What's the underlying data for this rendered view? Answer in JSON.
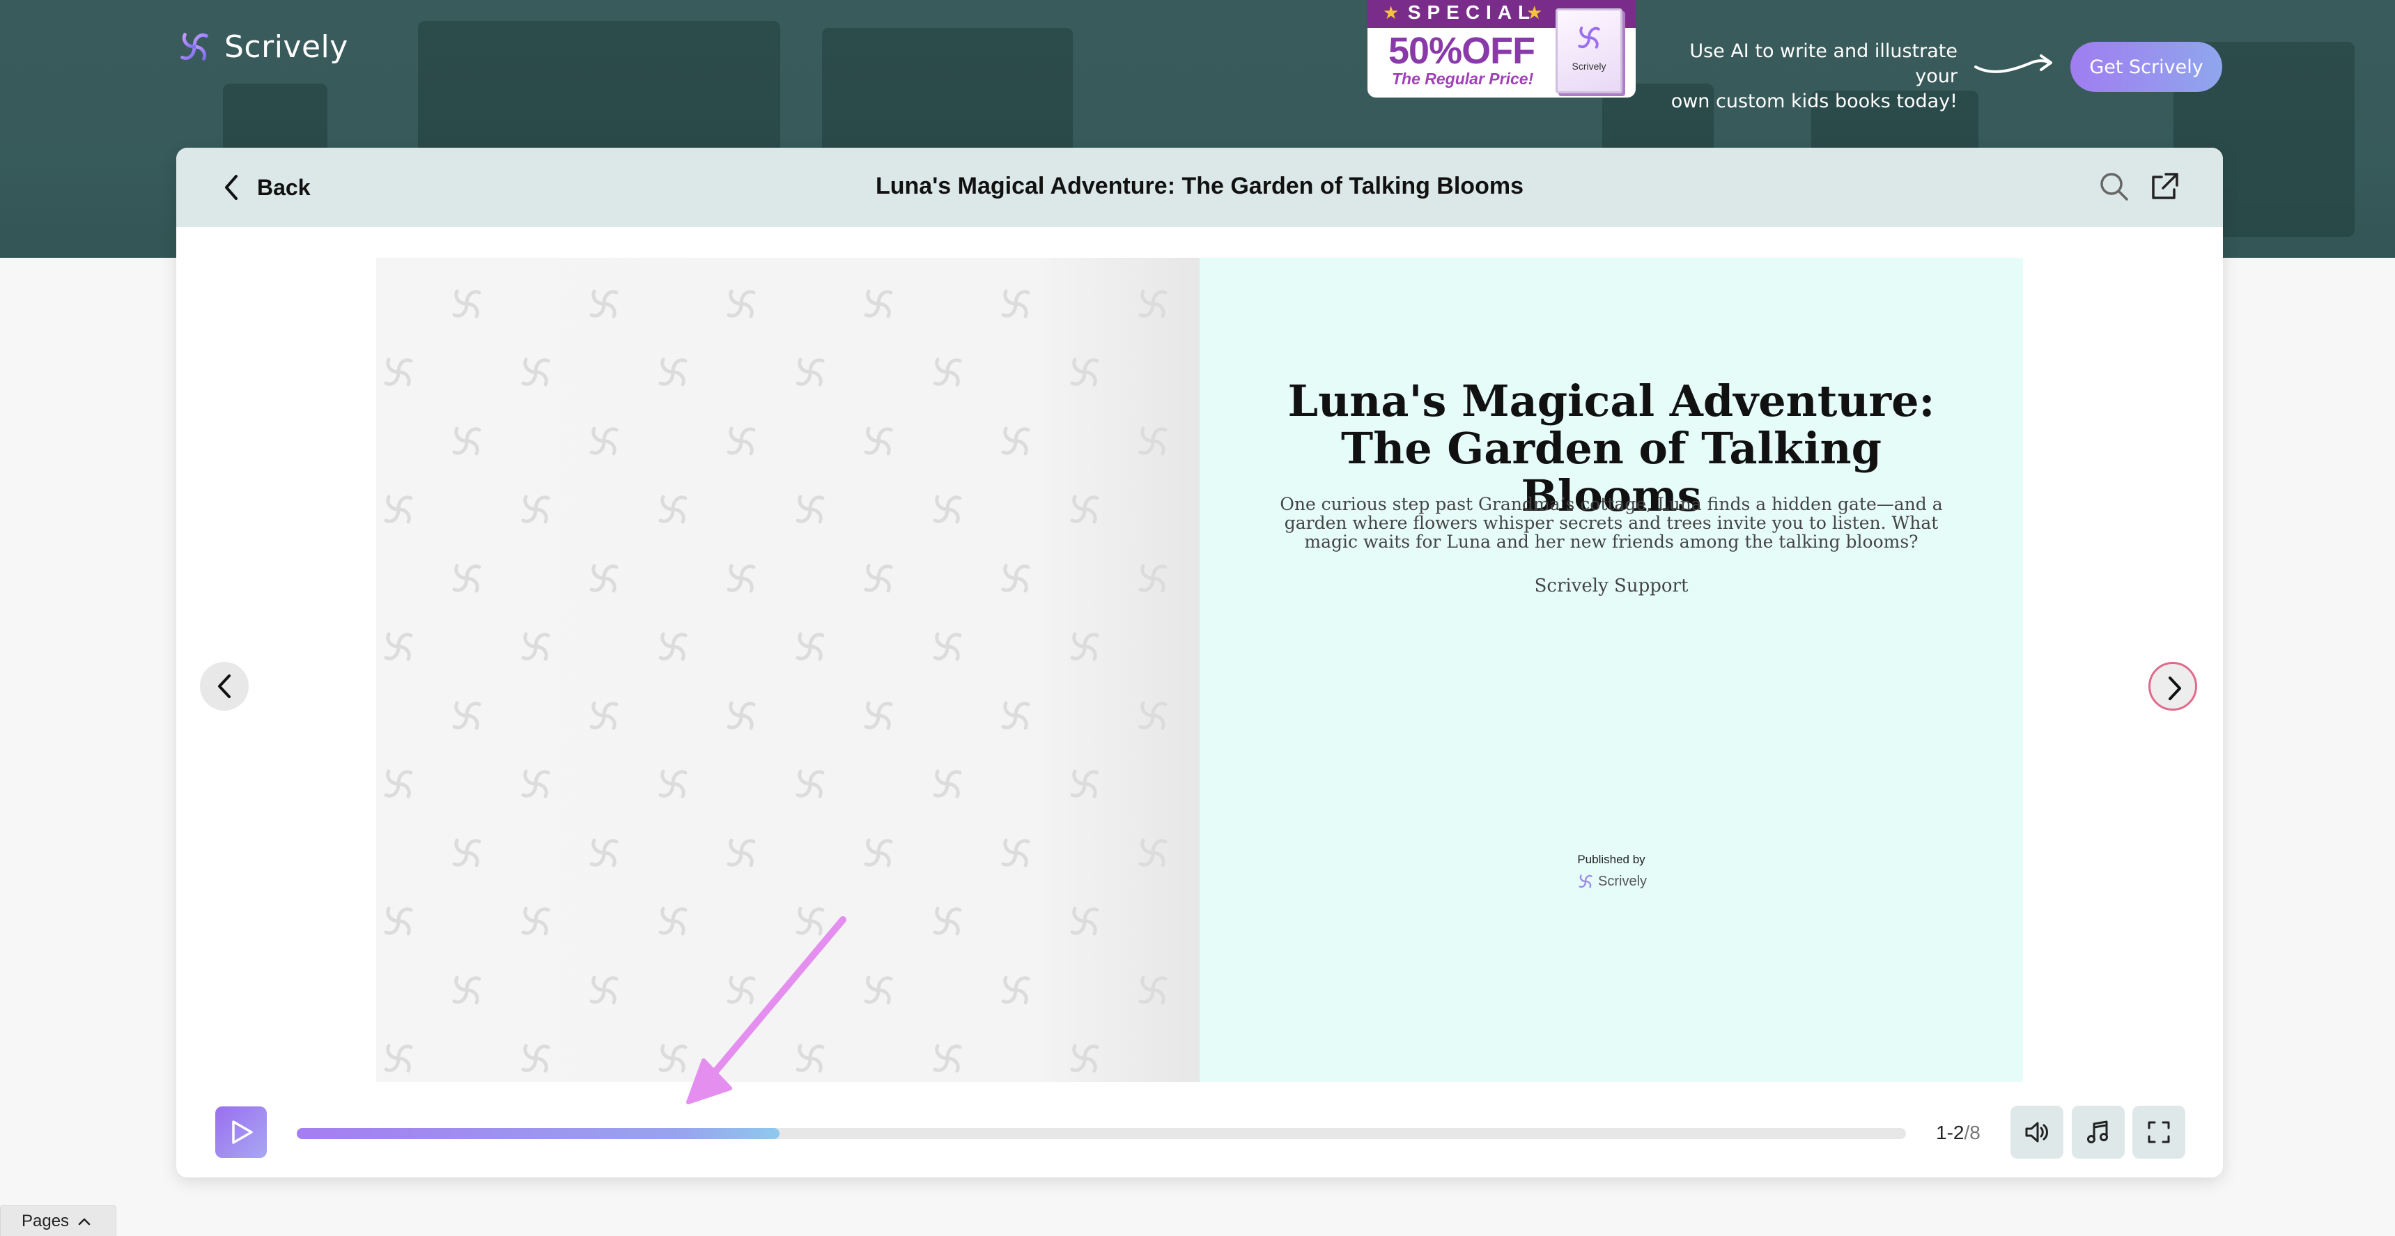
{
  "app": {
    "name": "Scrively"
  },
  "banner": {
    "promo": {
      "special": "SPECIAL",
      "discount": "50%OFF",
      "subtext": "The Regular Price!",
      "book_label": "Scrively"
    },
    "tagline_line1": "Use AI to write and illustrate your",
    "tagline_line2": "own custom kids books today!",
    "cta_label": "Get Scrively"
  },
  "reader": {
    "back_label": "Back",
    "title": "Luna's Magical Adventure: The Garden of Talking Blooms",
    "page": {
      "book_title": "Luna's Magical Adventure: The Garden of Talking Blooms",
      "description": "One curious step past Grandma’s cottage, Luna finds a hidden gate—and a garden where flowers whisper secrets and trees invite you to listen. What magic waits for Luna and her new friends among the talking blooms?",
      "author": "Scrively Support",
      "published_by": "Published by",
      "publisher": "Scrively"
    },
    "player": {
      "progress": 0.3,
      "page_range": "1-2",
      "page_total": "/8"
    },
    "icons": {
      "search": "search-icon",
      "share": "share-external-icon",
      "volume": "volume-icon",
      "music": "music-note-icon",
      "fullscreen": "fullscreen-icon",
      "play": "play-icon",
      "prev": "chevron-left-icon",
      "next": "chevron-right-icon"
    }
  },
  "pages_tab": {
    "label": "Pages"
  },
  "colors": {
    "brand_purple": "#a07df0",
    "header_teal": "#375a5a",
    "right_page_bg": "#e6fcf9",
    "next_ring": "#e06a8a",
    "annotation_arrow": "#e48ef0"
  }
}
